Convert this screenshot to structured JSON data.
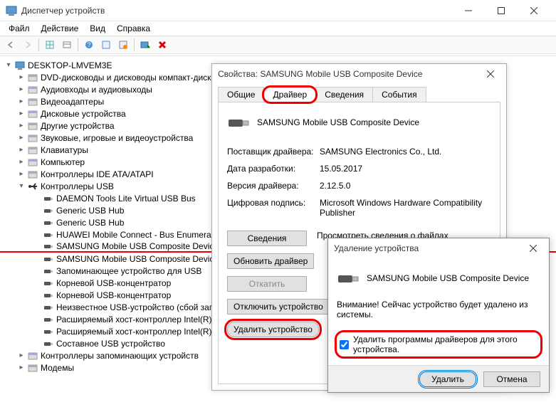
{
  "window": {
    "title": "Диспетчер устройств"
  },
  "menu": {
    "file": "Файл",
    "action": "Действие",
    "view": "Вид",
    "help": "Справка"
  },
  "tree": {
    "root": "DESKTOP-LMVEM3E",
    "items": [
      "DVD-дисководы и дисководы компакт-дисков",
      "Аудиовходы и аудиовыходы",
      "Видеоадаптеры",
      "Дисковые устройства",
      "Другие устройства",
      "Звуковые, игровые и видеоустройства",
      "Клавиатуры",
      "Компьютер",
      "Контроллеры IDE ATA/ATAPI"
    ],
    "usb_label": "Контроллеры USB",
    "usb": [
      "DAEMON Tools Lite Virtual USB Bus",
      "Generic USB Hub",
      "Generic USB Hub",
      "HUAWEI Mobile Connect - Bus Enumerator",
      "SAMSUNG Mobile USB Composite Device",
      "SAMSUNG Mobile USB Composite Device",
      "Запоминающее устройство для USB",
      "Корневой USB-концентратор",
      "Корневой USB-концентратор",
      "Неизвестное USB-устройство (сбой запроса)",
      "Расширяемый хост-контроллер Intel(R)",
      "Расширяемый хост-контроллер Intel(R)",
      "Составное USB устройство"
    ],
    "tail": [
      "Контроллеры запоминающих устройств",
      "Модемы"
    ]
  },
  "props": {
    "title": "Свойства: SAMSUNG Mobile USB Composite Device",
    "tabs": {
      "general": "Общие",
      "driver": "Драйвер",
      "details": "Сведения",
      "events": "События"
    },
    "device": "SAMSUNG Mobile USB Composite Device",
    "kv": {
      "vendor_k": "Поставщик драйвера:",
      "vendor_v": "SAMSUNG Electronics Co., Ltd.",
      "date_k": "Дата разработки:",
      "date_v": "15.05.2017",
      "ver_k": "Версия драйвера:",
      "ver_v": "2.12.5.0",
      "sig_k": "Цифровая подпись:",
      "sig_v": "Microsoft Windows Hardware Compatibility Publisher"
    },
    "btns": {
      "details": "Сведения",
      "details_desc": "Просмотреть сведения о файлах",
      "update": "Обновить драйвер",
      "rollback": "Откатить",
      "disable": "Отключить устройство",
      "uninstall": "Удалить устройство"
    }
  },
  "del": {
    "title": "Удаление устройства",
    "device": "SAMSUNG Mobile USB Composite Device",
    "warn": "Внимание! Сейчас устройство будет удалено из системы.",
    "chk": "Удалить программы драйверов для этого устройства.",
    "ok": "Удалить",
    "cancel": "Отмена"
  }
}
